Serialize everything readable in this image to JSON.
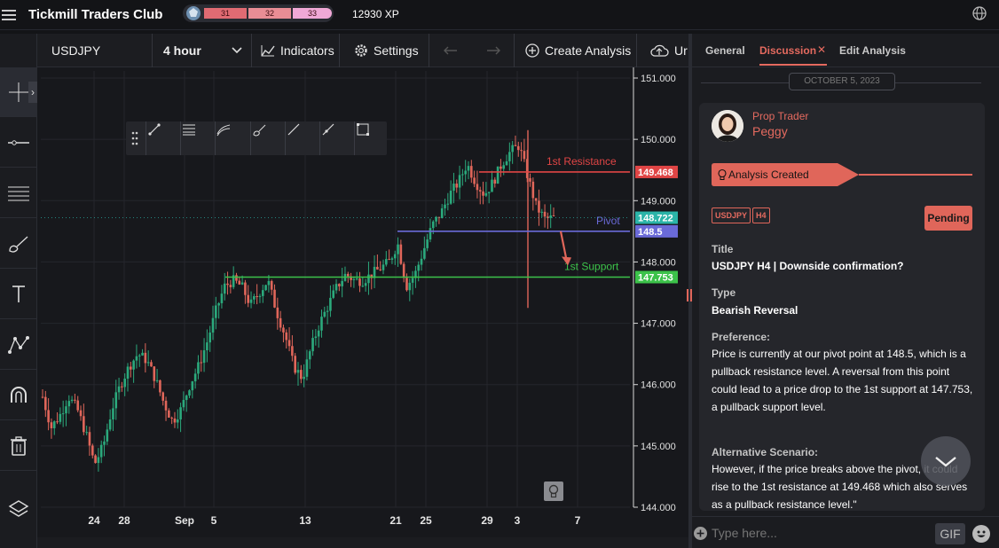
{
  "app": {
    "title": "Tickmill Traders Club",
    "xp": "12930 XP",
    "levels": [
      "31",
      "32",
      "33"
    ]
  },
  "toolbar": {
    "symbol": "USDJPY",
    "timeframe": "4 hour",
    "indicators": "Indicators",
    "settings": "Settings",
    "create_analysis": "Create Analysis",
    "upload": "Ur"
  },
  "chart_data": {
    "type": "candlestick",
    "symbol": "USDJPY",
    "timeframe": "4 hour",
    "ylim": [
      144.0,
      151.0
    ],
    "y_ticks": [
      "151.000",
      "150.000",
      "149.000",
      "148.000",
      "147.000",
      "146.000",
      "145.000",
      "144.000"
    ],
    "x_ticks": [
      "24",
      "28",
      "Sep",
      "5",
      "13",
      "21",
      "25",
      "29",
      "3",
      "7"
    ],
    "lines": [
      {
        "name": "1st Resistance",
        "value": 149.468,
        "tag": "149.468",
        "color": "#e04545"
      },
      {
        "name": "Pivot",
        "value": 148.5,
        "tag": "148.5",
        "color": "#6a6ad8"
      },
      {
        "name": "1st Support",
        "value": 147.753,
        "tag": "147.753",
        "color": "#3cc24a"
      }
    ],
    "last_price": {
      "value": 148.722,
      "tag": "148.722",
      "color": "#2bb4a8"
    },
    "candle_path": [
      145.8,
      145.3,
      145.5,
      145.8,
      145.6,
      145.2,
      144.7,
      145.0,
      145.6,
      146.0,
      146.3,
      146.5,
      146.4,
      146.1,
      145.7,
      145.4,
      145.6,
      146.0,
      146.3,
      146.7,
      147.2,
      147.6,
      147.7,
      147.6,
      147.3,
      147.5,
      147.7,
      147.2,
      146.8,
      146.3,
      146.1,
      146.6,
      147.0,
      147.3,
      147.6,
      147.8,
      147.7,
      147.7,
      147.8,
      147.9,
      148.0,
      148.3,
      147.6,
      147.8,
      148.2,
      148.6,
      148.8,
      149.1,
      149.3,
      149.6,
      149.3,
      149.1,
      149.3,
      149.6,
      149.8,
      149.9,
      149.4,
      148.9,
      148.7,
      148.72
    ]
  },
  "drawing_tools": [
    "arrow-tool-icon",
    "fib-tool-icon",
    "channel-tool-icon",
    "brush-tool-icon",
    "line-tool-icon",
    "ray-tool-icon",
    "rectangle-tool-icon"
  ],
  "panel": {
    "tabs": [
      "General",
      "Discussion",
      "Edit Analysis"
    ],
    "date": "OCTOBER 5, 2023",
    "author_role": "Prop Trader",
    "author_name": "Peggy",
    "banner": "Analysis Created",
    "tags": [
      "USDJPY",
      "H4"
    ],
    "status": "Pending",
    "title_label": "Title",
    "title_value": "USDJPY H4 | Downside confirmation?",
    "type_label": "Type",
    "type_value": "Bearish Reversal",
    "pref_label": "Preference:",
    "pref_text": "Price is currently at our pivot point at 148.5, which is a pullback resistance level. A reversal from this point could lead to a price drop to the 1st support at 147.753, a pullback support level.",
    "alt_label": "Alternative Scenario:",
    "alt_text": "However, if the price breaks above the pivot, it could rise to the 1st resistance at 149.468 which also serves as a pullback resistance level.\"",
    "input_placeholder": "Type here...",
    "gif": "GIF"
  }
}
